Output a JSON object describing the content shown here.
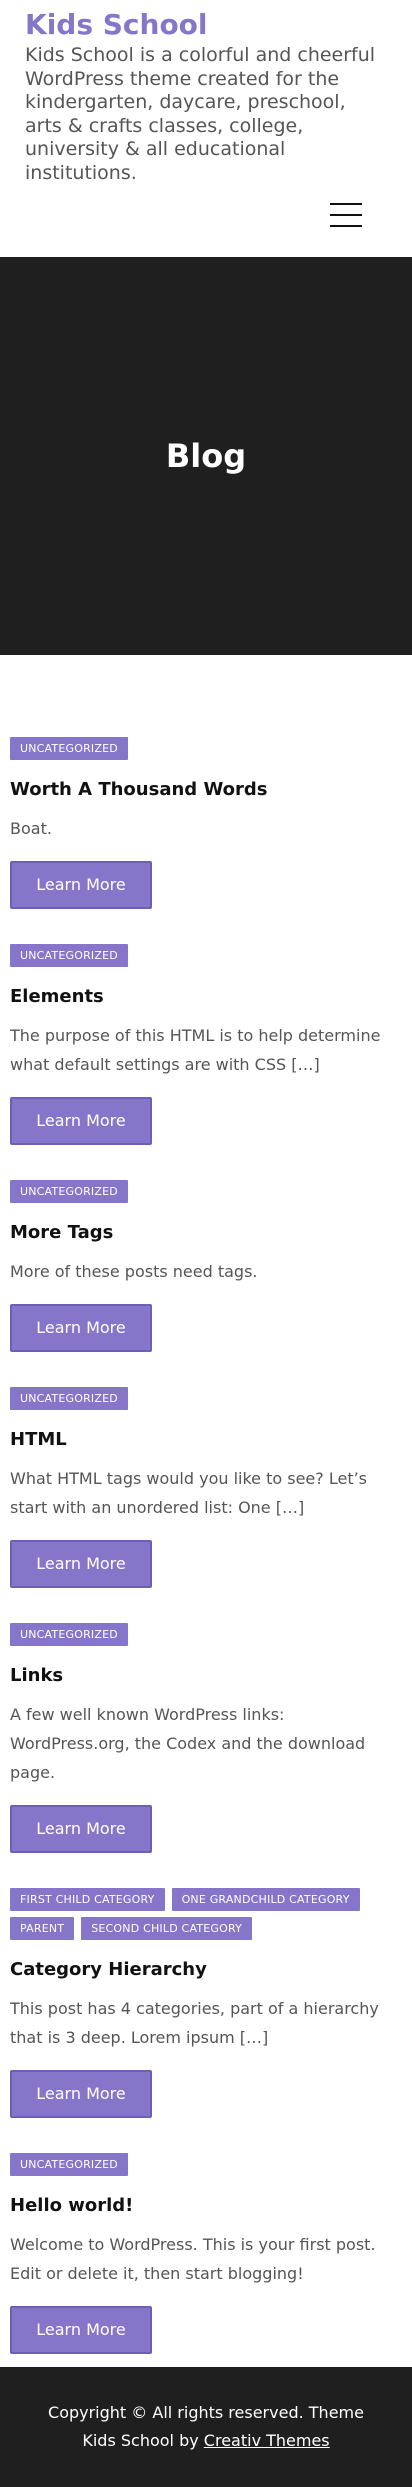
{
  "header": {
    "site_title": "Kids School",
    "tagline": "Kids School is a colorful and cheerful WordPress theme created for the kindergarten, daycare, preschool, arts & crafts classes, college, university & all educational institutions.",
    "menu_icon": "hamburger-menu-icon"
  },
  "hero": {
    "title": "Blog"
  },
  "posts": [
    {
      "categories": [
        "UNCATEGORIZED"
      ],
      "title": "Worth A Thousand Words",
      "excerpt": "Boat.",
      "button": "Learn More"
    },
    {
      "categories": [
        "UNCATEGORIZED"
      ],
      "title": "Elements",
      "excerpt": "The purpose of this HTML is to help determine what default settings are with CSS […]",
      "button": "Learn More"
    },
    {
      "categories": [
        "UNCATEGORIZED"
      ],
      "title": "More Tags",
      "excerpt": "More of these posts need tags.",
      "button": "Learn More"
    },
    {
      "categories": [
        "UNCATEGORIZED"
      ],
      "title": "HTML",
      "excerpt": "What HTML tags would you like to see? Let’s start with an unordered list: One […]",
      "button": "Learn More"
    },
    {
      "categories": [
        "UNCATEGORIZED"
      ],
      "title": "Links",
      "excerpt": "A few well known WordPress links: WordPress.org, the Codex and the download page.",
      "button": "Learn More"
    },
    {
      "categories": [
        "FIRST CHILD CATEGORY",
        "ONE GRANDCHILD CATEGORY",
        "PARENT",
        "SECOND CHILD CATEGORY"
      ],
      "title": "Category Hierarchy",
      "excerpt": "This post has 4 categories, part of a hierarchy that is 3 deep. Lorem ipsum […]",
      "button": "Learn More"
    },
    {
      "categories": [
        "UNCATEGORIZED"
      ],
      "title": "Hello world!",
      "excerpt": "Welcome to WordPress. This is your first post. Edit or delete it, then start blogging!",
      "button": "Learn More"
    }
  ],
  "footer": {
    "text": "Copyright © All rights reserved. Theme Kids School by",
    "link": "Creativ Themes"
  },
  "colors": {
    "accent": "#8676c9",
    "dark": "#1f1f1f"
  }
}
